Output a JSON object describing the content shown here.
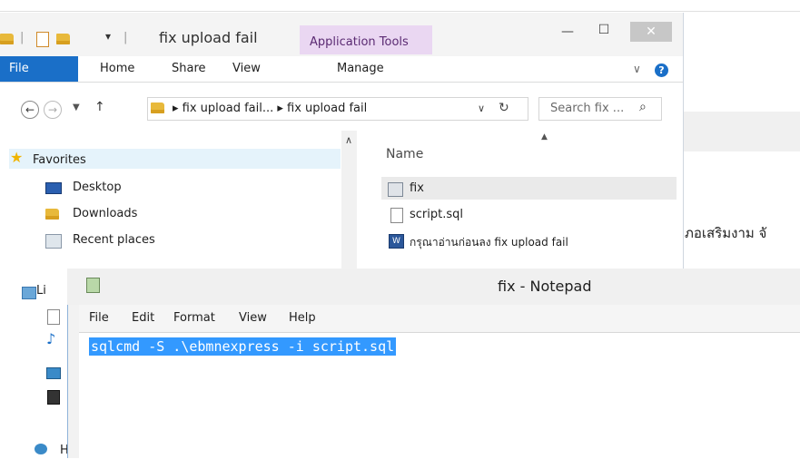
{
  "explorer": {
    "title": "fix upload fail",
    "context_tab": "Application Tools",
    "ribbon_tabs": [
      "File",
      "Home",
      "Share",
      "View",
      "Manage"
    ],
    "address_path": "▸ fix upload fail... ▸ fix upload fail",
    "search_placeholder": "Search fix ...",
    "column_header": "Name",
    "nav_items": [
      {
        "label": "Favorites",
        "icon": "star-icon"
      },
      {
        "label": "Desktop",
        "icon": "desktop-icon"
      },
      {
        "label": "Downloads",
        "icon": "downloads-icon"
      },
      {
        "label": "Recent places",
        "icon": "recent-places-icon"
      },
      {
        "label": "Li",
        "icon": "libraries-icon"
      },
      {
        "label": "H",
        "icon": "homegroup-icon"
      }
    ],
    "files": [
      {
        "name": "fix",
        "icon": "batch-file-icon"
      },
      {
        "name": "script.sql",
        "icon": "blank-file-icon"
      },
      {
        "name": "กรุณาอ่านก่อนลง fix upload fail",
        "icon": "word-doc-icon"
      }
    ]
  },
  "background_text": "ภอเสริมงาม จั",
  "notepad": {
    "title": "fix - Notepad",
    "menu": [
      "File",
      "Edit",
      "Format",
      "View",
      "Help"
    ],
    "content": "sqlcmd -S .\\ebmnexpress -i script.sql"
  },
  "colors": {
    "accent": "#1a6fc8",
    "context_tab": "#ead7f2",
    "selection": "#3399ff"
  }
}
